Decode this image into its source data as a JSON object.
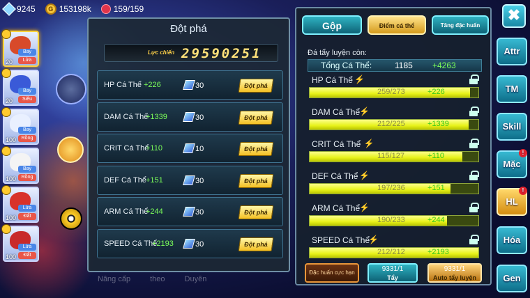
{
  "top": {
    "gems": "9245",
    "gold": "153198k",
    "stamina": "159/159",
    "coin_glyph": "G"
  },
  "left_list": [
    {
      "level": "20",
      "tags": [
        "Bay",
        "Lửa"
      ],
      "color": "#d84a2a"
    },
    {
      "level": "20",
      "tags": [
        "Bay",
        "Siêu"
      ],
      "color": "#3a5ad8"
    },
    {
      "level": "100",
      "tags": [
        "Bay",
        "Rồng"
      ],
      "color": "#e9f0ff"
    },
    {
      "level": "100",
      "tags": [
        "Bay",
        "Rồng"
      ],
      "color": "#f4f4f4"
    },
    {
      "level": "100",
      "tags": [
        "Lửa",
        "Đất"
      ],
      "color": "#d8322a"
    },
    {
      "level": "100",
      "tags": [
        "Lửa",
        "Đất"
      ],
      "color": "#c82a2a"
    }
  ],
  "mid": {
    "title": "Đột phá",
    "power_label": "Lực chiến",
    "power_value": "29590251",
    "button_label": "Đột phá",
    "rows": [
      {
        "name": "HP Cá Thể",
        "plus": "+226",
        "gems": "30"
      },
      {
        "name": "DAM Cá Thể",
        "plus": "+1339",
        "gems": "30"
      },
      {
        "name": "CRIT Cá Thể",
        "plus": "+110",
        "gems": "10"
      },
      {
        "name": "DEF Cá Thể",
        "plus": "+151",
        "gems": "30"
      },
      {
        "name": "ARM Cá Thể",
        "plus": "+244",
        "gems": "30"
      },
      {
        "name": "SPEED Cá Thể",
        "plus": "+2193",
        "gems": "30"
      }
    ]
  },
  "right": {
    "tabs": [
      "Gộp",
      "Điểm cá thể",
      "Tăng đặc huấn"
    ],
    "remain_label": "Đá tẩy luyện còn:",
    "total_label": "Tổng Cá Thể:",
    "total_value": "1185",
    "total_plus": "+4263",
    "bars": [
      {
        "name": "HP Cá Thể",
        "value": "259/273",
        "plus": "+226",
        "fraction": 0.949
      },
      {
        "name": "DAM Cá Thể",
        "value": "212/225",
        "plus": "+1339",
        "fraction": 0.942
      },
      {
        "name": "CRIT Cá Thể",
        "value": "115/127",
        "plus": "+110",
        "fraction": 0.906
      },
      {
        "name": "DEF Cá Thể",
        "value": "197/236",
        "plus": "+151",
        "fraction": 0.835
      },
      {
        "name": "ARM Cá Thể",
        "value": "190/233",
        "plus": "+244",
        "fraction": 0.815
      },
      {
        "name": "SPEED Cá Thể",
        "value": "212/212",
        "plus": "+2193",
        "fraction": 1.0
      }
    ],
    "bottom": {
      "special": "Đặc huấn cực hạn",
      "wash_count": "9331/1",
      "wash_label": "Tẩy",
      "auto_count": "9331/1",
      "auto_label": "Auto tẩy luyện"
    }
  },
  "menu": {
    "close": "✖",
    "items": [
      {
        "label": "Attr",
        "badge": ""
      },
      {
        "label": "TM",
        "badge": ""
      },
      {
        "label": "Skill",
        "badge": ""
      },
      {
        "label": "Mặc",
        "badge": "!"
      },
      {
        "label": "HL",
        "badge": "!"
      },
      {
        "label": "Hóa",
        "badge": ""
      },
      {
        "label": "Gen",
        "badge": ""
      }
    ]
  },
  "underlay": [
    "Nâng cấp",
    "theo",
    "Duyên"
  ]
}
